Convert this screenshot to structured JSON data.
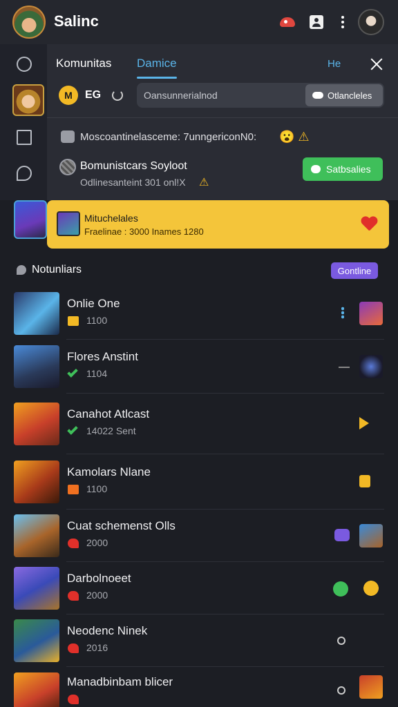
{
  "app": {
    "title": "Salinc"
  },
  "header_icons": [
    "mushroom-icon",
    "profile-icon",
    "more-icon",
    "user-avatar"
  ],
  "panel": {
    "tabs": [
      {
        "label": "Komunitas"
      },
      {
        "label": "Damice"
      }
    ],
    "active_tab": "Damice",
    "help_label": "He",
    "coin_symbol": "M",
    "level_text": "EG",
    "search_text": "Oansunnerialnod",
    "search_button": "Otlancleles",
    "notif1_text": "Moscoantinelasceme: 7unngericonN0:",
    "notif1_emoji": "😮 ⚠",
    "notif2_title": "Bomunistcars Soyloot",
    "notif2_sub": "Odlinesanteint 301 onl!X",
    "notif2_warn": "⚠",
    "green_button": "Satbsalies"
  },
  "banner": {
    "title": "Mituchelales",
    "subtitle": "Fraelinae : 3000 Inames 1280"
  },
  "section": {
    "title": "Notunliars",
    "pill": "Gontline"
  },
  "games": [
    {
      "title": "Onlie One",
      "count": "1100",
      "badge": "bag"
    },
    {
      "title": "Flores Anstint",
      "count": "1104",
      "badge": "check"
    },
    {
      "title": "Canahot Atlcast",
      "count": "14022 Sent",
      "badge": "check"
    },
    {
      "title": "Kamolars Nlane",
      "count": "1100",
      "badge": "bag"
    },
    {
      "title": "Cuat schemenst Olls",
      "count": "2000",
      "badge": "heart"
    },
    {
      "title": "Darbolnoeet",
      "count": "2000",
      "badge": "heart"
    },
    {
      "title": "Neodenc Ninek",
      "count": "2016",
      "badge": "heart"
    },
    {
      "title": "Manadbinbam blicer",
      "count": "",
      "badge": "heart"
    }
  ],
  "colors": {
    "background": "#1c1e24",
    "accent_blue": "#5ab4e8",
    "banner_yellow": "#f4c53a",
    "green": "#3fbf5a",
    "purple": "#7a5ae0"
  }
}
